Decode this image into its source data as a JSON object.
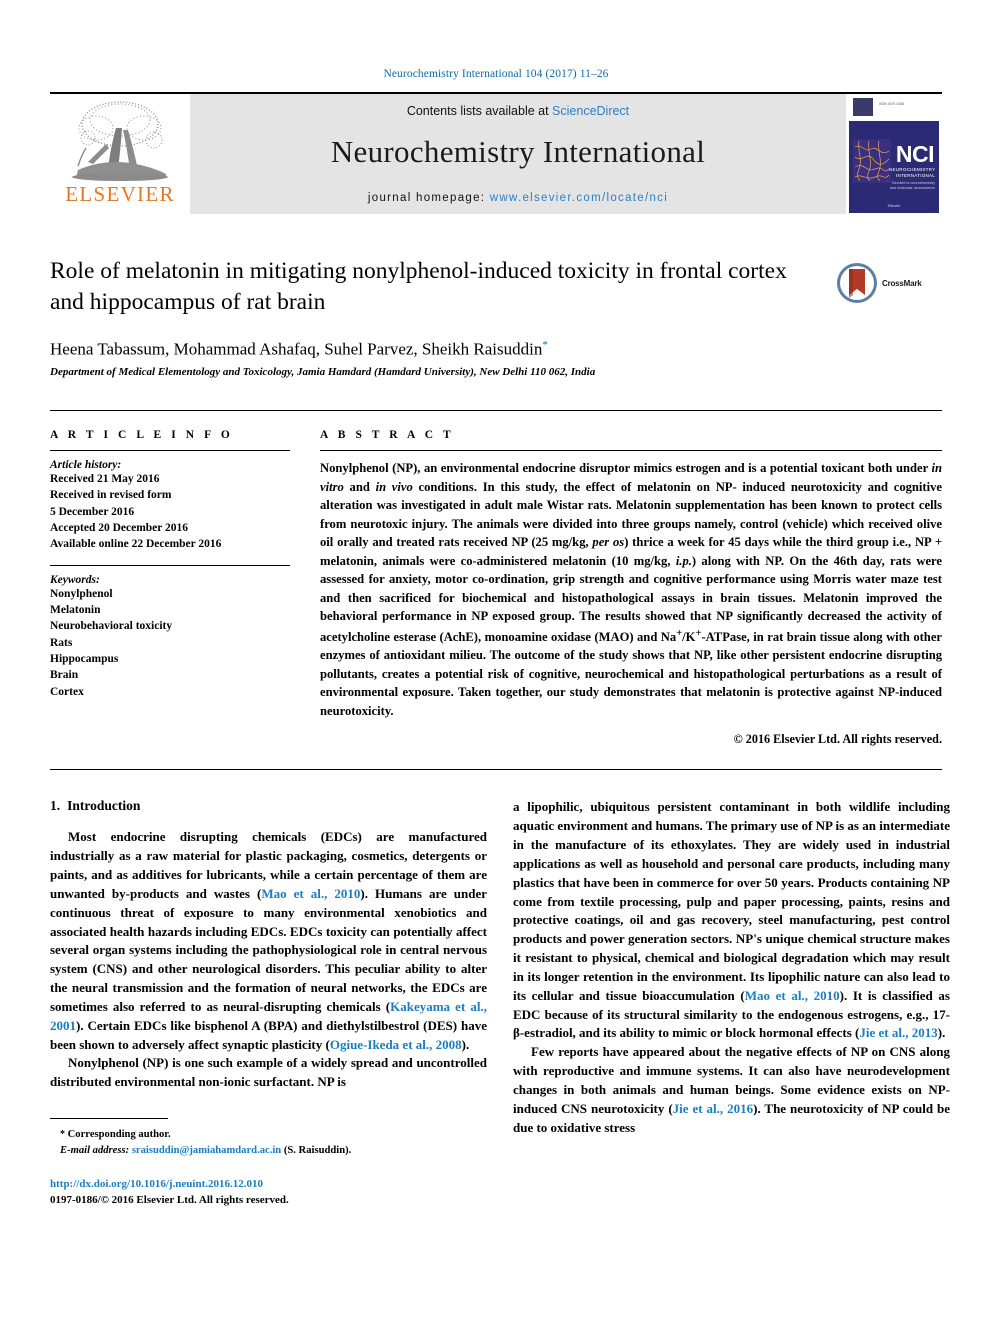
{
  "running_head": "Neurochemistry International 104 (2017) 11–26",
  "masthead": {
    "publisher": "ELSEVIER",
    "contents_prefix": "Contents lists available at ",
    "contents_link": "ScienceDirect",
    "journal_title": "Neurochemistry International",
    "homepage_label": "journal homepage: ",
    "homepage_url": "www.elsevier.com/locate/nci",
    "cover": {
      "acronym": "NCI",
      "sub": "NEUROCHEMISTRY INTERNATIONAL",
      "sub2": "Devoted to neurochemistry and molecular neuroscience",
      "footer": "Editor-in-Chief\nElsevier"
    }
  },
  "article": {
    "title": "Role of melatonin in mitigating nonylphenol-induced toxicity in frontal cortex and hippocampus of rat brain",
    "authors": "Heena Tabassum, Mohammad Ashafaq, Suhel Parvez, Sheikh Raisuddin",
    "author_marker": "*",
    "affiliation": "Department of Medical Elementology and Toxicology, Jamia Hamdard (Hamdard University), New Delhi 110 062, India",
    "crossmark_label": "CrossMark"
  },
  "info": {
    "heading": "A R T I C L E    I N F O",
    "history_label": "Article history:",
    "history": [
      "Received 21 May 2016",
      "Received in revised form",
      "5 December 2016",
      "Accepted 20 December 2016",
      "Available online 22 December 2016"
    ],
    "keywords_label": "Keywords:",
    "keywords": [
      "Nonylphenol",
      "Melatonin",
      "Neurobehavioral toxicity",
      "Rats",
      "Hippocampus",
      "Brain",
      "Cortex"
    ]
  },
  "abstract": {
    "heading": "A B S T R A C T",
    "text_part1": "Nonylphenol (NP), an environmental endocrine disruptor mimics estrogen and is a potential toxicant both under ",
    "italic1": "in vitro",
    "text_part2": " and ",
    "italic2": "in vivo",
    "text_part3": " conditions. In this study, the effect of melatonin on NP- induced neurotoxicity and cognitive alteration was investigated in adult male Wistar rats. Melatonin supplementation has been known to protect cells from neurotoxic injury. The animals were divided into three groups namely, control (vehicle) which received olive oil orally and treated rats received NP (25 mg/kg, ",
    "italic3": "per os",
    "text_part4": ") thrice a week for 45 days while the third group i.e., NP + melatonin, animals were co-administered melatonin (10 mg/kg, ",
    "italic4": "i.p.",
    "text_part5": ") along with NP. On the 46th day, rats were assessed for anxiety, motor co-ordination, grip strength and cognitive performance using Morris water maze test and then sacrificed for biochemical and histopathological assays in brain tissues. Melatonin improved the behavioral performance in NP exposed group. The results showed that NP significantly decreased the activity of acetylcholine esterase (AchE), monoamine oxidase (MAO) and Na",
    "sup1": "+",
    "text_part6": "/K",
    "sup2": "+",
    "text_part7": "-ATPase, in rat brain tissue along with other enzymes of antioxidant milieu. The outcome of the study shows that NP, like other persistent endocrine disrupting pollutants, creates a potential risk of cognitive, neurochemical and histopathological perturbations as a result of environmental exposure. Taken together, our study demonstrates that melatonin is protective against NP-induced neurotoxicity.",
    "copyright": "© 2016 Elsevier Ltd. All rights reserved."
  },
  "body": {
    "section_number": "1.",
    "section_title": "Introduction",
    "left_paragraph_1_a": "Most endocrine disrupting chemicals (EDCs) are manufactured industrially as a raw material for plastic packaging, cosmetics, detergents or paints, and as additives for lubricants, while a certain percentage of them are unwanted by-products and wastes (",
    "left_ref_1": "Mao et al., 2010",
    "left_paragraph_1_b": "). Humans are under continuous threat of exposure to many environmental xenobiotics and associated health hazards including EDCs. EDCs toxicity can potentially affect several organ systems including the pathophysiological role in central nervous system (CNS) and other neurological disorders. This peculiar ability to alter the neural transmission and the formation of neural networks, the EDCs are sometimes also referred to as neural-disrupting chemicals (",
    "left_ref_2": "Kakeyama et al., 2001",
    "left_paragraph_1_c": "). Certain EDCs like bisphenol A (BPA) and diethylstilbestrol (DES) have been shown to adversely affect synaptic plasticity (",
    "left_ref_3": "Ogiue-Ikeda et al., 2008",
    "left_paragraph_1_d": ").",
    "left_paragraph_2": "Nonylphenol (NP) is one such example of a widely spread and uncontrolled distributed environmental non-ionic surfactant. NP is",
    "right_paragraph_1_a": "a lipophilic, ubiquitous persistent contaminant in both wildlife including aquatic environment and humans. The primary use of NP is as an intermediate in the manufacture of its ethoxylates. They are widely used in industrial applications as well as household and personal care products, including many plastics that have been in commerce for over 50 years. Products containing NP come from textile processing, pulp and paper processing, paints, resins and protective coatings, oil and gas recovery, steel manufacturing, pest control products and power generation sectors. NP's unique chemical structure makes it resistant to physical, chemical and biological degradation which may result in its longer retention in the environment. Its lipophilic nature can also lead to its cellular and tissue bioaccumulation (",
    "right_ref_1": "Mao et al., 2010",
    "right_paragraph_1_b": "). It is classified as EDC because of its structural similarity to the endogenous estrogens, e.g., 17-β-estradiol, and its ability to mimic or block hormonal effects (",
    "right_ref_2": "Jie et al., 2013",
    "right_paragraph_1_c": ").",
    "right_paragraph_2_a": "Few reports have appeared about the negative effects of NP on CNS along with reproductive and immune systems. It can also have neurodevelopment changes in both animals and human beings. Some evidence exists on NP-induced CNS neurotoxicity (",
    "right_ref_3": "Jie et al., 2016",
    "right_paragraph_2_b": "). The neurotoxicity of NP could be due to oxidative stress"
  },
  "footer": {
    "corresponding_marker": "*",
    "corresponding_label": "Corresponding author.",
    "email_label": "E-mail address:",
    "email": "sraisuddin@jamiahamdard.ac.in",
    "email_owner": "(S. Raisuddin).",
    "doi": "http://dx.doi.org/10.1016/j.neuint.2016.12.010",
    "issn_line": "0197-0186/© 2016 Elsevier Ltd. All rights reserved."
  },
  "colors": {
    "link": "#1a7fc1",
    "running_head": "#0b6ca8",
    "elsevier_orange": "#e87722",
    "masthead_bg": "#e4e4e4",
    "cover_bg": "#2c2a74"
  }
}
